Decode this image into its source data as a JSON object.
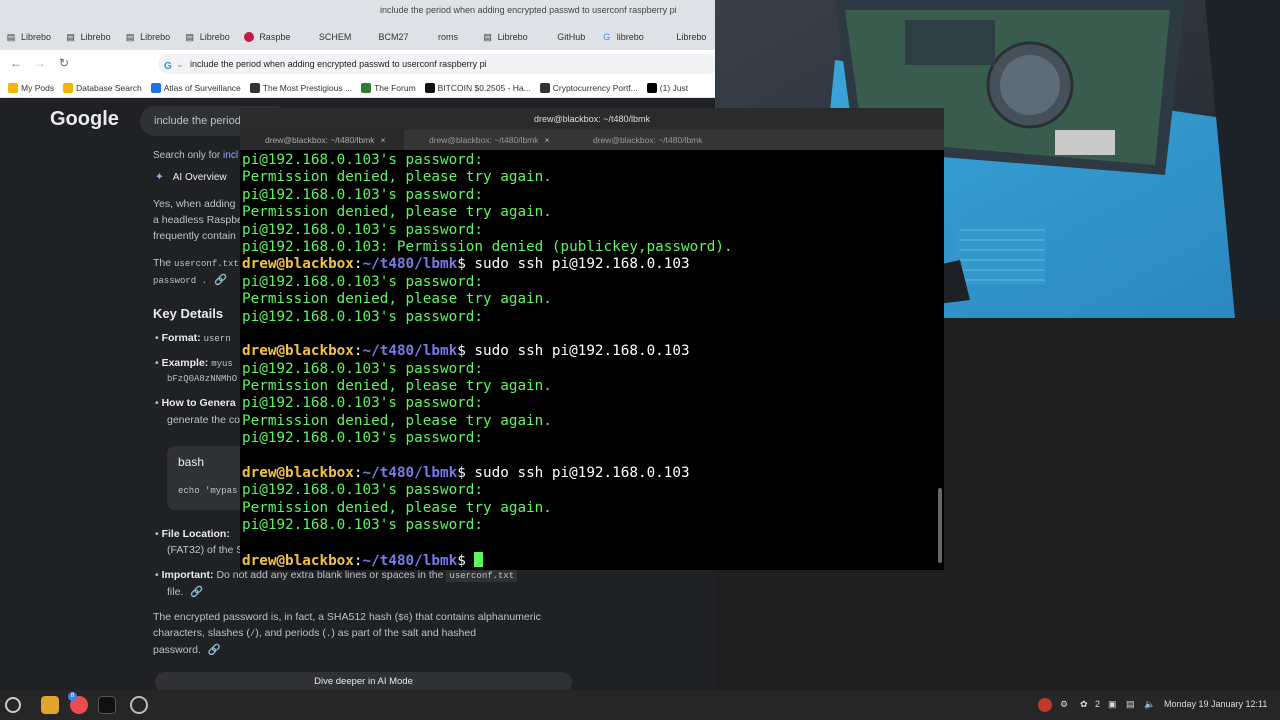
{
  "browser": {
    "window_title": "include the period when adding encrypted passwd to userconf raspberry pi",
    "tabs": [
      {
        "icon": "doc-icon",
        "label": "Librebo"
      },
      {
        "icon": "doc-icon",
        "label": "Librebo"
      },
      {
        "icon": "doc-icon",
        "label": "Librebo"
      },
      {
        "icon": "doc-icon",
        "label": "Librebo"
      },
      {
        "icon": "raspberry-icon",
        "label": "Raspbe"
      },
      {
        "icon": "",
        "label": "SCHEM"
      },
      {
        "icon": "",
        "label": "BCM27"
      },
      {
        "icon": "",
        "label": "roms"
      },
      {
        "icon": "doc-icon",
        "label": "Librebo"
      },
      {
        "icon": "",
        "label": "GitHub"
      },
      {
        "icon": "google-icon",
        "label": "librebo"
      },
      {
        "icon": "",
        "label": "Librebo"
      }
    ],
    "address": "include the period when adding encrypted passwd to userconf raspberry pi",
    "bookmarks": [
      {
        "label": "My Pods",
        "color": "#f4b400"
      },
      {
        "label": "Database Search",
        "color": "#f4b400"
      },
      {
        "label": "Atlas of Surveillance",
        "color": "#1a73e8"
      },
      {
        "label": "The Most Prestigious ...",
        "color": "#333333"
      },
      {
        "label": "The Forum",
        "color": "#2e7d32"
      },
      {
        "label": "BITCOIN $0.2505 - Ha...",
        "color": "#111111"
      },
      {
        "label": "Cryptocurrency Portf...",
        "color": "#333333"
      },
      {
        "label": "(1) Just",
        "color": "#000000"
      }
    ]
  },
  "page": {
    "logo": "Google",
    "search_text": "include the period",
    "search_only_prefix": "Search only for",
    "search_only_link": "incl",
    "ai_overview_label": "AI Overview",
    "ai_intro": [
      "Yes, when adding",
      "a headless Raspbe",
      "frequently contain"
    ],
    "the_text": "The",
    "the_code": "userconf.txt",
    "password_code": "password .",
    "key_details": "Key Details",
    "bullets": {
      "format_label": "Format:",
      "format_value": "usern",
      "example_label": "Example:",
      "example_value": "myus",
      "example_hash": "bFzQ0A8zNNMhO",
      "howto_label": "How to Genera",
      "howto_text": "generate the co"
    },
    "code_lang": "bash",
    "code_text": "echo 'mypas",
    "file_location_label": "File Location:",
    "file_location_text": "(FAT32) of the S",
    "important_label": "Important:",
    "important_text": "Do not add any extra blank lines or spaces in the",
    "important_code": "userconf.txt",
    "important_tail": "file.",
    "para": [
      "The encrypted password is, in fact, a SHA512 hash (",
      "$6",
      ") that contains alphanumeric",
      "characters, slashes (",
      "/",
      "), and periods (",
      ".",
      ") as part of the salt and hashed",
      "password."
    ],
    "dive_button": "Dive deeper in AI Mode"
  },
  "terminal": {
    "title": "drew@blackbox: ~/t480/lbmk",
    "tabs": [
      "drew@blackbox: ~/t480/lbmk",
      "drew@blackbox: ~/t480/lbmk",
      "drew@blackbox: ~/t480/lbmk"
    ],
    "prompt_user": "drew@blackbox",
    "prompt_colon": ":",
    "prompt_path": "~/t480/lbmk",
    "prompt_dollar": "$",
    "lines": [
      {
        "text": "pi@192.168.0.103's password:"
      },
      {
        "text": "Permission denied, please try again."
      },
      {
        "text": "pi@192.168.0.103's password:"
      },
      {
        "text": "Permission denied, please try again."
      },
      {
        "text": "pi@192.168.0.103's password:"
      },
      {
        "text": "pi@192.168.0.103: Permission denied (publickey,password)."
      },
      {
        "prompt": true,
        "cmd": " sudo ssh pi@192.168.0.103"
      },
      {
        "text": "pi@192.168.0.103's password:"
      },
      {
        "text": "Permission denied, please try again."
      },
      {
        "text": "pi@192.168.0.103's password:"
      },
      {
        "text": ""
      },
      {
        "prompt": true,
        "cmd": " sudo ssh pi@192.168.0.103"
      },
      {
        "text": "pi@192.168.0.103's password:"
      },
      {
        "text": "Permission denied, please try again."
      },
      {
        "text": "pi@192.168.0.103's password:"
      },
      {
        "text": "Permission denied, please try again."
      },
      {
        "text": "pi@192.168.0.103's password:"
      },
      {
        "text": ""
      },
      {
        "prompt": true,
        "cmd": " sudo ssh pi@192.168.0.103"
      },
      {
        "text": "pi@192.168.0.103's password:"
      },
      {
        "text": "Permission denied, please try again."
      },
      {
        "text": "pi@192.168.0.103's password:"
      },
      {
        "text": ""
      },
      {
        "prompt": true,
        "cmd": " ",
        "cursor": true
      }
    ]
  },
  "taskbar": {
    "workspace": "2",
    "clock": "Monday 19 January 12:11",
    "badge": "8"
  },
  "colors": {
    "terminal_green": "#5ff55f",
    "prompt_user": "#f2c341",
    "prompt_path": "#7a7ae8"
  }
}
